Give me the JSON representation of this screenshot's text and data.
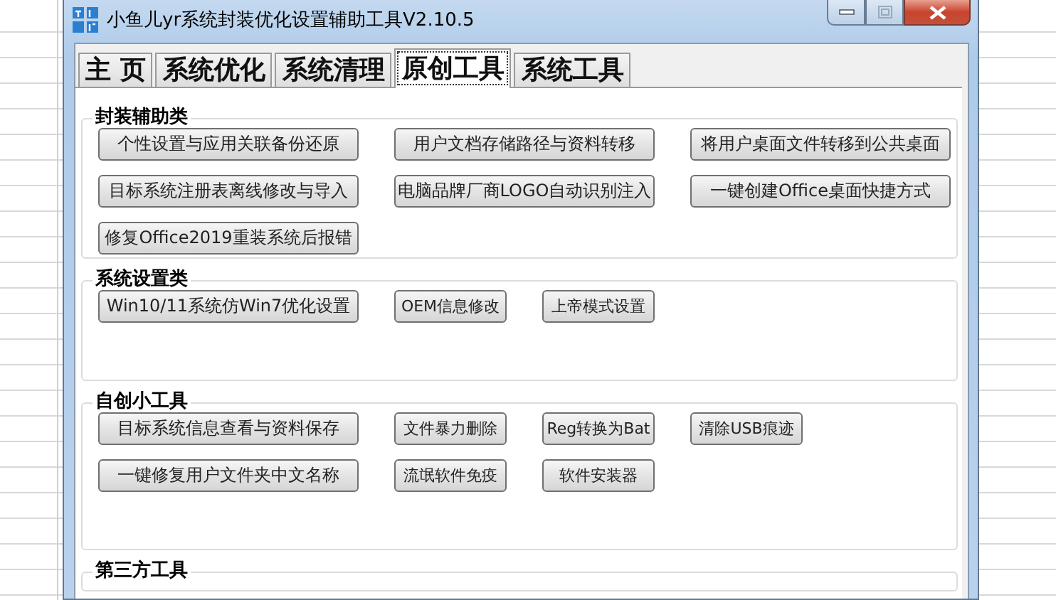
{
  "window": {
    "title": "小鱼儿yr系统封装优化设置辅助工具V2.10.5"
  },
  "tabs": [
    {
      "label": "主 页",
      "selected": false
    },
    {
      "label": "系统优化",
      "selected": false
    },
    {
      "label": "系统清理",
      "selected": false
    },
    {
      "label": "原创工具",
      "selected": true
    },
    {
      "label": "系统工具",
      "selected": false
    }
  ],
  "groups": [
    {
      "title": "封装辅助类",
      "rows": [
        [
          {
            "label": "个性设置与应用关联备份还原",
            "kind": "wide"
          },
          {
            "label": "用户文档存储路径与资料转移",
            "kind": "wide"
          },
          {
            "label": "将用户桌面文件转移到公共桌面",
            "kind": "wide"
          }
        ],
        [
          {
            "label": "目标系统注册表离线修改与导入",
            "kind": "wide"
          },
          {
            "label": "电脑品牌厂商LOGO自动识别注入",
            "kind": "wide"
          },
          {
            "label": "一键创建Office桌面快捷方式",
            "kind": "wide"
          }
        ],
        [
          {
            "label": "修复Office2019重装系统后报错",
            "kind": "wide"
          }
        ]
      ]
    },
    {
      "title": "系统设置类",
      "rows": [
        [
          {
            "label": "Win10/11系统仿Win7优化设置",
            "kind": "wide"
          },
          {
            "label": "OEM信息修改",
            "kind": "narrow"
          },
          {
            "label": "上帝模式设置",
            "kind": "narrow"
          }
        ]
      ]
    },
    {
      "title": "自创小工具",
      "rows": [
        [
          {
            "label": "目标系统信息查看与资料保存",
            "kind": "wide"
          },
          {
            "label": "文件暴力删除",
            "kind": "narrow"
          },
          {
            "label": "Reg转换为Bat",
            "kind": "narrow"
          },
          {
            "label": "清除USB痕迹",
            "kind": "narrow"
          }
        ],
        [
          {
            "label": "一键修复用户文件夹中文名称",
            "kind": "wide"
          },
          {
            "label": "流氓软件免疫",
            "kind": "narrow"
          },
          {
            "label": "软件安装器",
            "kind": "narrow"
          }
        ]
      ]
    },
    {
      "title": "第三方工具"
    }
  ]
}
